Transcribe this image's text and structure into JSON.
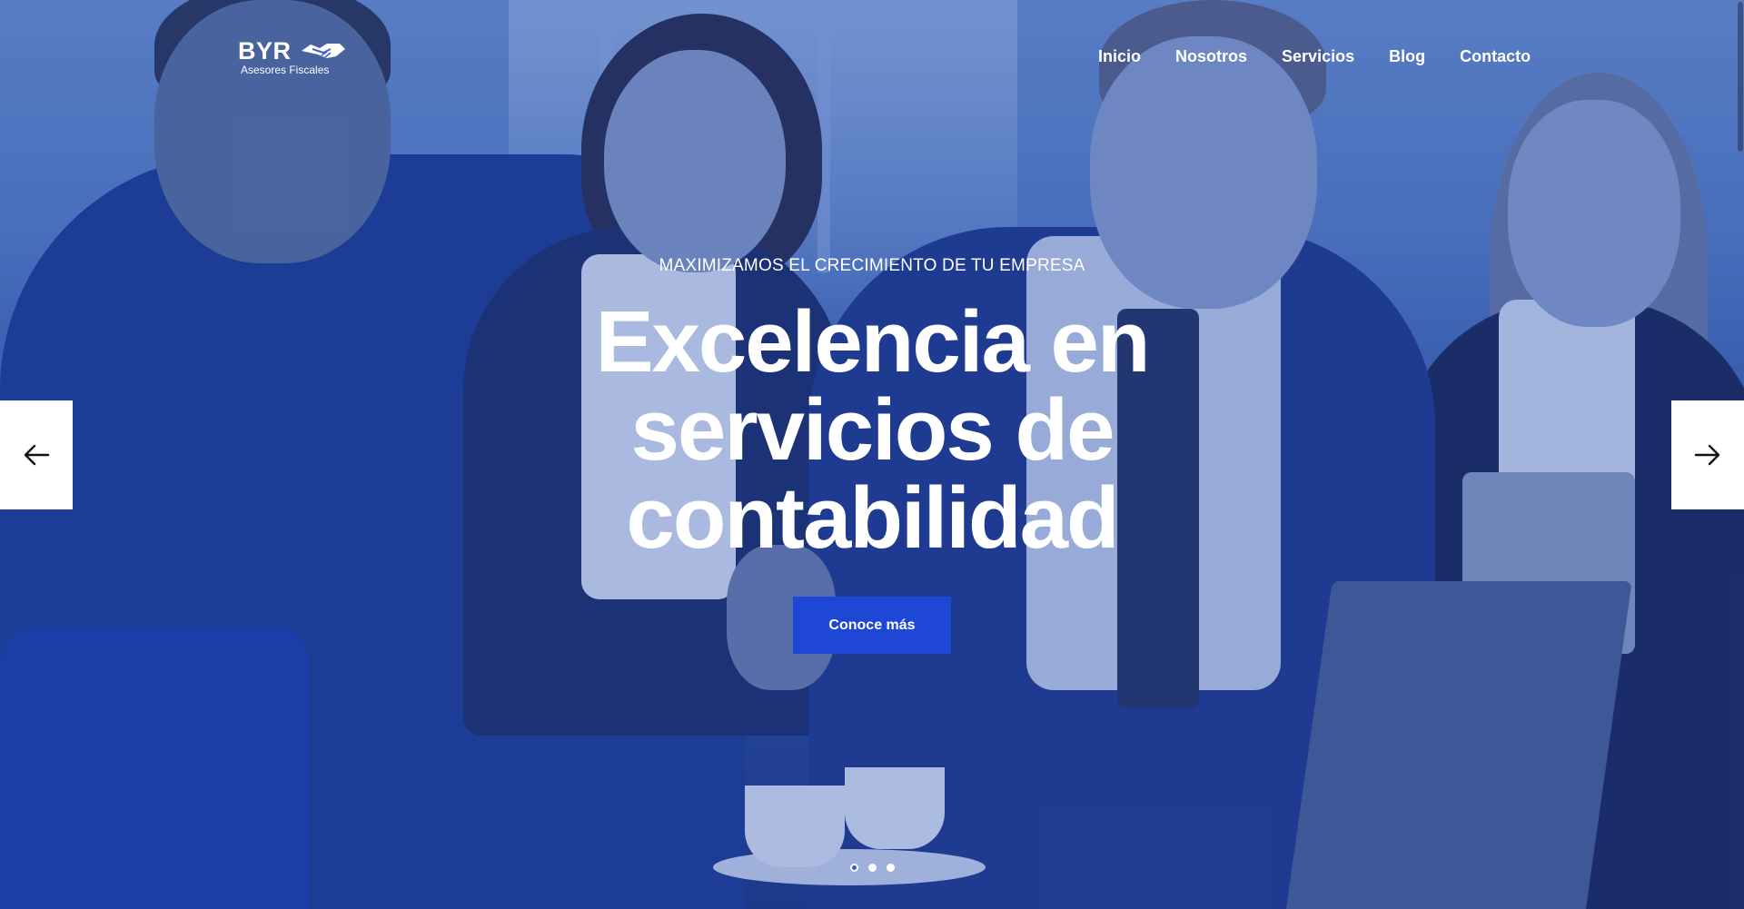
{
  "brand": {
    "name": "BYR",
    "tagline": "Asesores Fiscales",
    "icon": "handshake-icon"
  },
  "nav": {
    "items": [
      {
        "label": "Inicio"
      },
      {
        "label": "Nosotros"
      },
      {
        "label": "Servicios"
      },
      {
        "label": "Blog"
      },
      {
        "label": "Contacto"
      }
    ]
  },
  "hero": {
    "kicker": "MAXIMIZAMOS EL CRECIMIENTO DE TU EMPRESA",
    "headline": "Excelencia en servicios de contabilidad",
    "cta_label": "Conoce más"
  },
  "slider": {
    "prev_icon": "arrow-left-icon",
    "next_icon": "arrow-right-icon",
    "slide_count": 3,
    "active_slide": 1
  },
  "colors": {
    "accent": "#1f47d6",
    "overlay": "#1e46aa",
    "text": "#ffffff"
  }
}
